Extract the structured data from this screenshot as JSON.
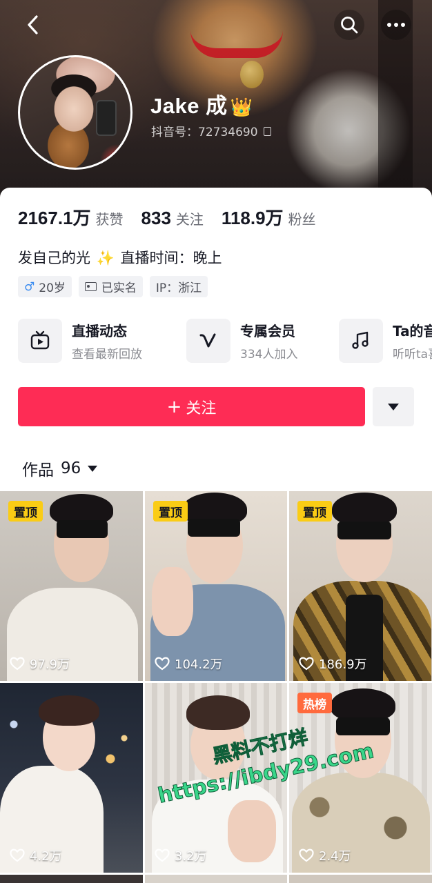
{
  "header": {
    "nickname": "Jake 成",
    "crown_icon": "👑",
    "douyin_id_label": "抖音号：",
    "douyin_id": "72734690"
  },
  "stats": [
    {
      "value": "2167.1万",
      "label": "获赞"
    },
    {
      "value": "833",
      "label": "关注"
    },
    {
      "value": "118.9万",
      "label": "粉丝"
    }
  ],
  "bio": {
    "text_before": "发自己的光",
    "sparkle": "✨",
    "text_after": "直播时间：晚上"
  },
  "tags": [
    {
      "icon": "male-icon",
      "glyph": "♂",
      "text": "20岁"
    },
    {
      "icon": "id-card-icon",
      "text": "已实名"
    },
    {
      "text": "IP：浙江"
    }
  ],
  "features": [
    {
      "icon": "live-tv-icon",
      "title": "直播动态",
      "subtitle": "查看最新回放"
    },
    {
      "icon": "member-v-icon",
      "title": "专属会员",
      "subtitle": "334人加入"
    },
    {
      "icon": "music-note-icon",
      "title": "Ta的音乐",
      "subtitle": "听听ta喜欢的"
    }
  ],
  "actions": {
    "follow_plus": "+",
    "follow_label": "关注"
  },
  "works": {
    "label": "作品",
    "count": "96"
  },
  "videos": [
    {
      "badge": "置顶",
      "badge_type": "pin",
      "likes": "97.9万"
    },
    {
      "badge": "置顶",
      "badge_type": "pin",
      "likes": "104.2万"
    },
    {
      "badge": "置顶",
      "badge_type": "pin",
      "likes": "186.9万"
    },
    {
      "badge": "",
      "badge_type": "",
      "likes": "4.2万"
    },
    {
      "badge": "",
      "badge_type": "",
      "likes": "3.2万"
    },
    {
      "badge": "热榜",
      "badge_type": "hot",
      "likes": "2.4万"
    }
  ],
  "watermark": {
    "line1": "黑料不打烊",
    "line2": "https://ibdy29.com"
  },
  "colors": {
    "accent": "#fe2c55",
    "pin_badge": "#facc15",
    "hot_badge": "#ff6a3d"
  }
}
